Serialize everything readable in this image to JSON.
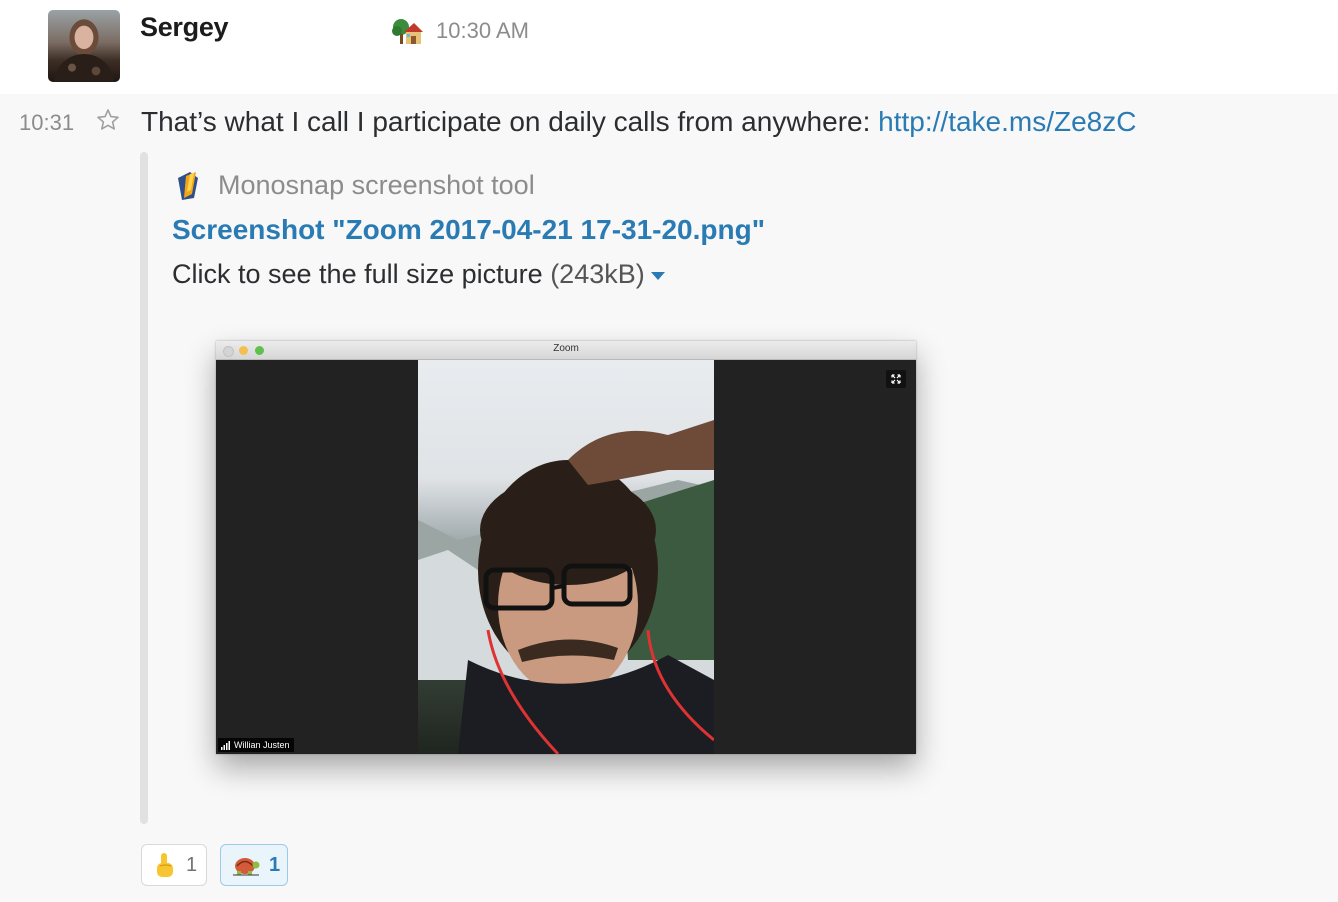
{
  "message": {
    "author": "Sergey",
    "header_time": "10:30 AM",
    "status_emoji": "house-with-garden-icon",
    "line_time": "10:31",
    "text": "That’s what I call I participate on daily calls from anywhere: ",
    "link": "http://take.ms/Ze8zC"
  },
  "attachment": {
    "service_name": "Monosnap screenshot tool",
    "service_icon": "monosnap-icon",
    "title": "Screenshot \"Zoom 2017-04-21 17-31-20.png\"",
    "description": "Click to see the full size picture",
    "size": "(243kB)",
    "preview": {
      "window_title": "Zoom",
      "participant_name": "Willian Justen"
    }
  },
  "reactions": [
    {
      "emoji": "point-up-icon",
      "count": "1"
    },
    {
      "emoji": "turtle-icon",
      "count": "1"
    }
  ],
  "colors": {
    "link": "#2a7bb4",
    "muted": "#8c8c8c",
    "body_bg": "#f8f8f8"
  }
}
